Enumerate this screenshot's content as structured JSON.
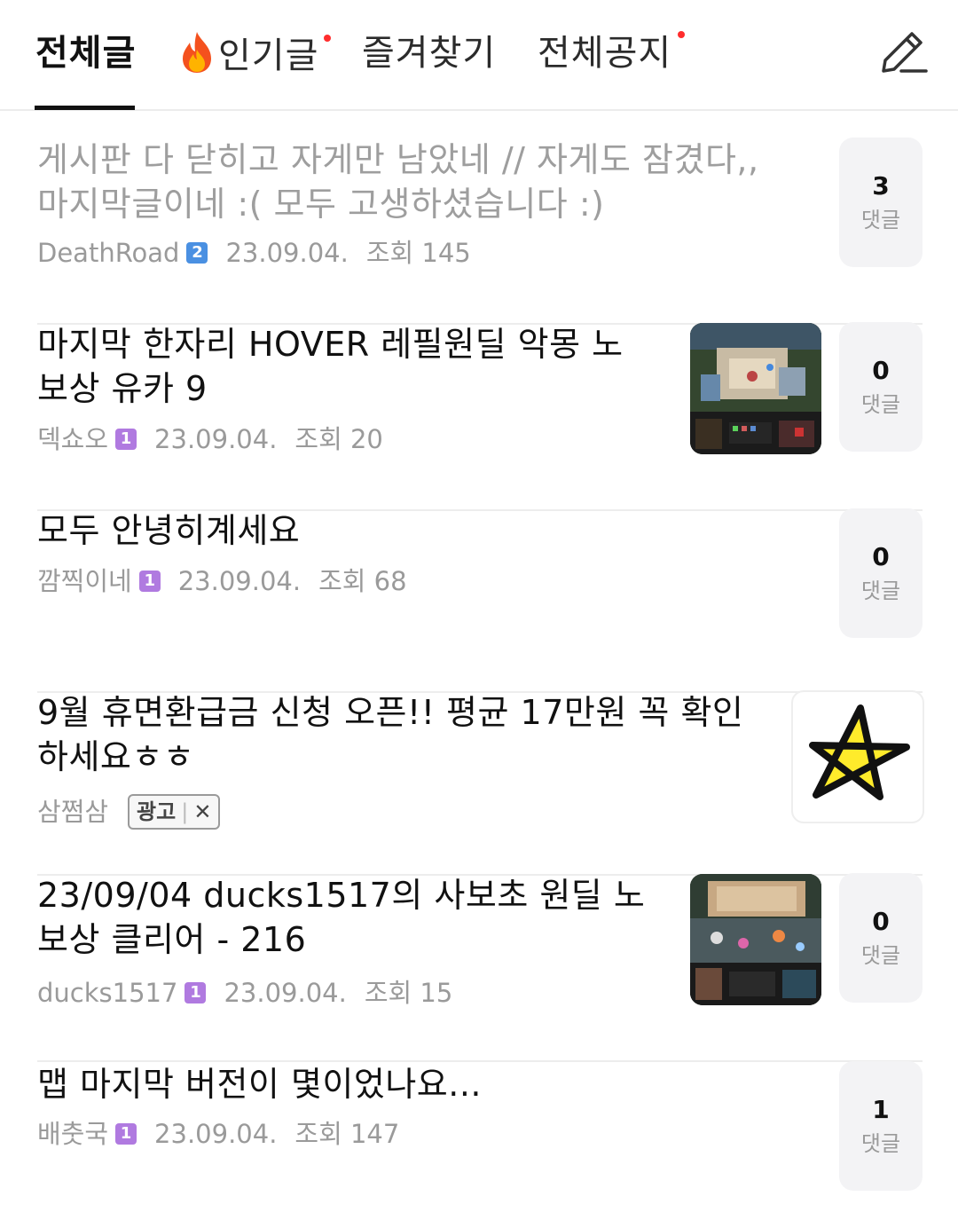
{
  "tabs": [
    {
      "label": "전체글",
      "active": true,
      "new": false
    },
    {
      "label": "인기글",
      "active": false,
      "new": true,
      "icon": "fire-icon"
    },
    {
      "label": "즐겨찾기",
      "active": false,
      "new": false
    },
    {
      "label": "전체공지",
      "active": false,
      "new": true
    }
  ],
  "compose_icon": "pencil-icon",
  "comment_label": "댓글",
  "posts": [
    {
      "title_line1": "게시판 다 닫히고 자게만 남았네 // 자게도 잠겼다,,",
      "title_line2": "마지막글이네 :( 모두 고생하셨습니다 :)",
      "author": "DeathRoad",
      "level": "2",
      "date": "23.09.04.",
      "views": "조회 145",
      "comments": "3",
      "read": true
    },
    {
      "title_line1": "마지막 한자리 HOVER 레필원딜 악몽 노",
      "title_line2": "보상 유카 9",
      "author": "덱쇼오",
      "level": "1",
      "date": "23.09.04.",
      "views": "조회 20",
      "comments": "0"
    },
    {
      "title_line1": "모두 안녕히계세요",
      "author": "깜찍이네",
      "level": "1",
      "date": "23.09.04.",
      "views": "조회 68",
      "comments": "0"
    },
    {
      "title_line1": "9월 휴면환급금 신청 오픈!! 평균 17만원 꼭 확인",
      "title_line2": "하세요ㅎㅎ",
      "author": "삼쩜삼",
      "ad_label": "광고",
      "ad_close": "✕"
    },
    {
      "title_line1": "23/09/04 ducks1517의 사보초 원딜 노",
      "title_line2": "보상 클리어 - 216",
      "author": "ducks1517",
      "level": "1",
      "date": "23.09.04.",
      "views": "조회 15",
      "comments": "0"
    },
    {
      "title_line1": "맵 마지막 버전이 몇이었나요...",
      "author": "배춧국",
      "level": "1",
      "date": "23.09.04.",
      "views": "조회 147",
      "comments": "1"
    }
  ],
  "colors": {
    "level1": "#b07ae0",
    "level2": "#4a90e2",
    "new_dot": "#ff2d2d",
    "active_tab": "#111111"
  }
}
